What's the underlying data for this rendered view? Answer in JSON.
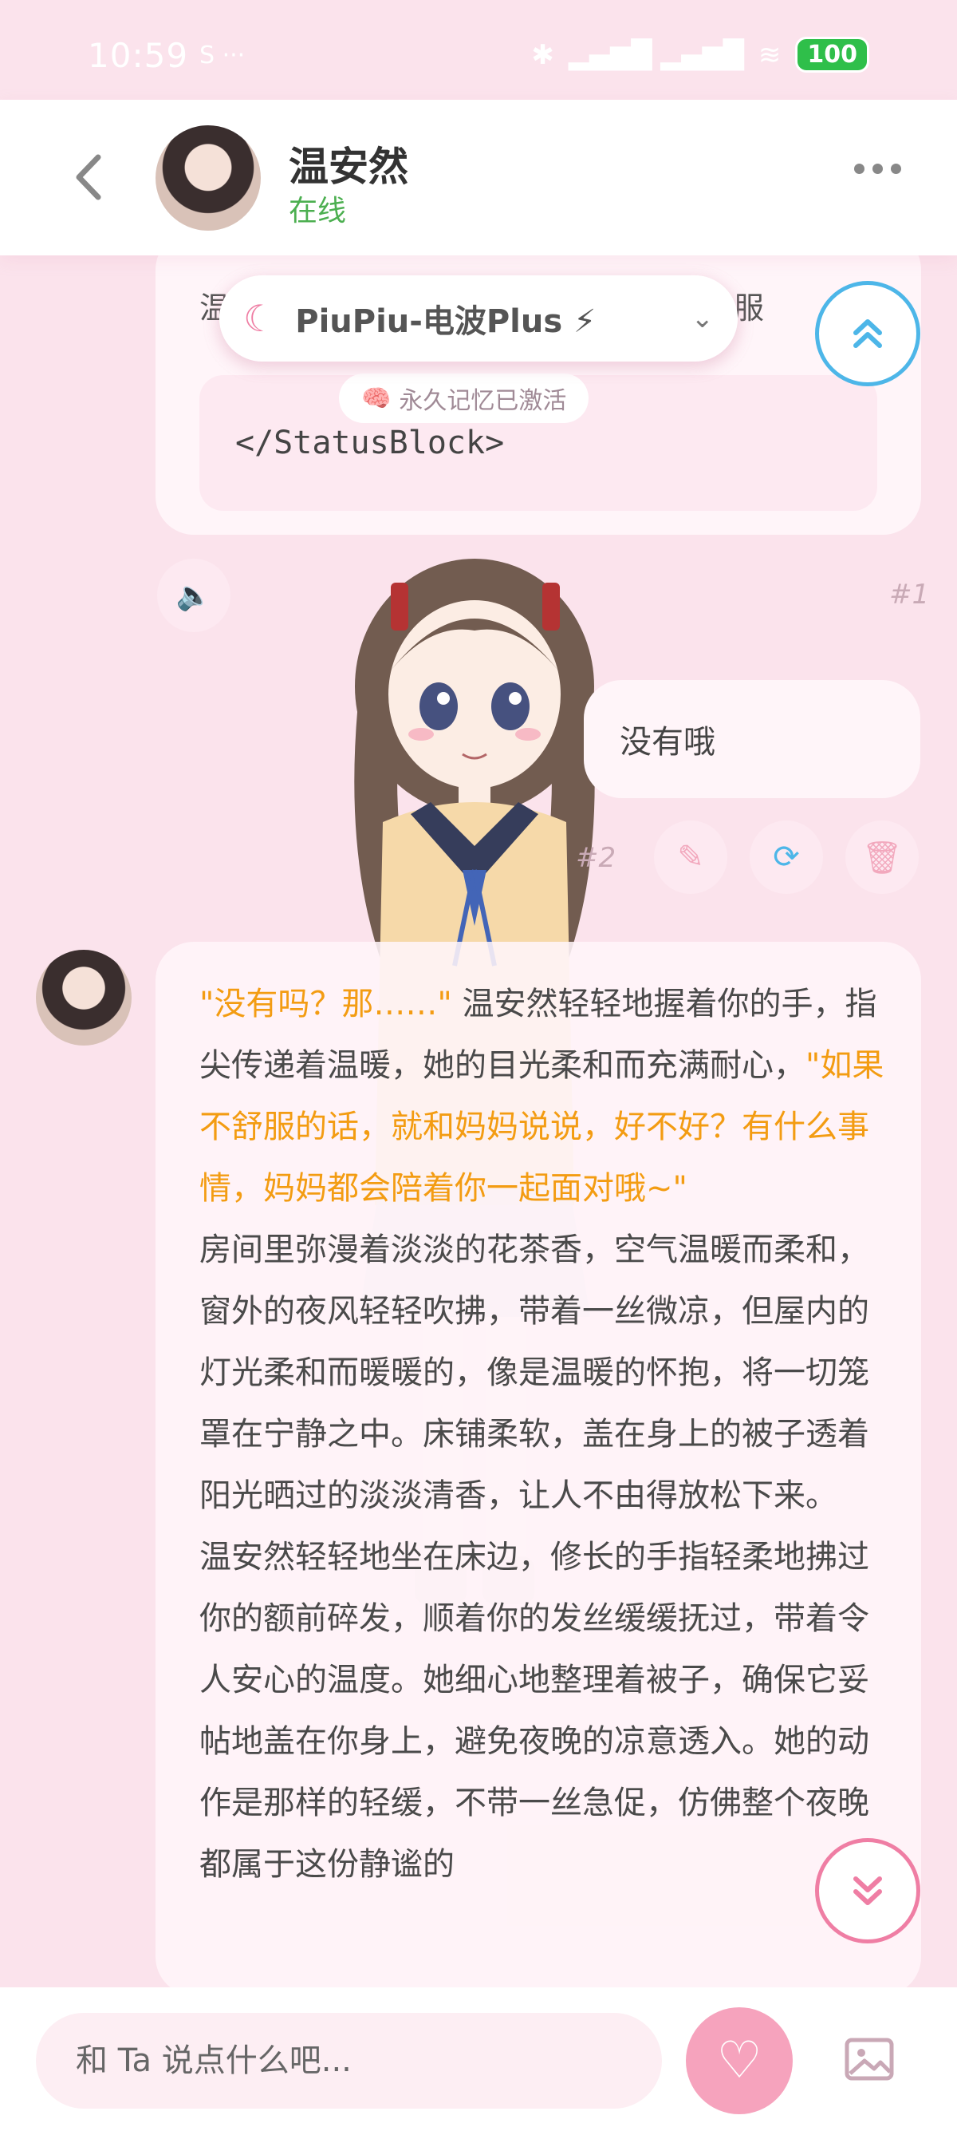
{
  "status_bar": {
    "time": "10:59",
    "battery": "100"
  },
  "header": {
    "name": "温安然",
    "status": "在线"
  },
  "top_message": {
    "partial_line_start": "温",
    "partial_line_end": "服",
    "status_block": "</StatusBlock>",
    "memory_badge": "永久记忆已激活",
    "index": "#1"
  },
  "model_selector": {
    "label": "PiuPiu-电波Plus ⚡"
  },
  "user_message": {
    "text": "没有哦",
    "index": "#2"
  },
  "ai_message": {
    "p1_quote1": "\"没有吗？那……\"",
    "p1_narr1": " 温安然轻轻地握着你的手，指尖传递着温暖，她的目光柔和而充满耐心，",
    "p1_quote2": "\"如果不舒服的话，就和妈妈说说，好不好？有什么事情，妈妈都会陪着你一起面对哦~\"",
    "p2": "房间里弥漫着淡淡的花茶香，空气温暖而柔和，窗外的夜风轻轻吹拂，带着一丝微凉，但屋内的灯光柔和而暖暖的，像是温暖的怀抱，将一切笼罩在宁静之中。床铺柔软，盖在身上的被子透着阳光晒过的淡淡清香，让人不由得放松下来。",
    "p3": "温安然轻轻地坐在床边，修长的手指轻柔地拂过你的额前碎发，顺着你的发丝缓缓抚过，带着令人安心的温度。她细心地整理着被子，确保它妥帖地盖在你身上，避免夜晚的凉意透入。她的动作是那样的轻缓，不带一丝急促，仿佛整个夜晚都属于这份静谧的"
  },
  "input": {
    "placeholder": "和 Ta 说点什么吧..."
  },
  "colors": {
    "accent_pink": "#ef7ea4",
    "quote_orange": "#f39c12",
    "online_green": "#4caf50",
    "scroll_up_blue": "#4db6e8"
  },
  "icons": [
    "back-icon",
    "more-icon",
    "moon-icon",
    "chevron-down-icon",
    "double-chevron-up-icon",
    "brain-icon",
    "speaker-icon",
    "pencil-icon",
    "refresh-icon",
    "trash-icon",
    "double-chevron-down-icon",
    "heart-icon",
    "image-icon"
  ]
}
